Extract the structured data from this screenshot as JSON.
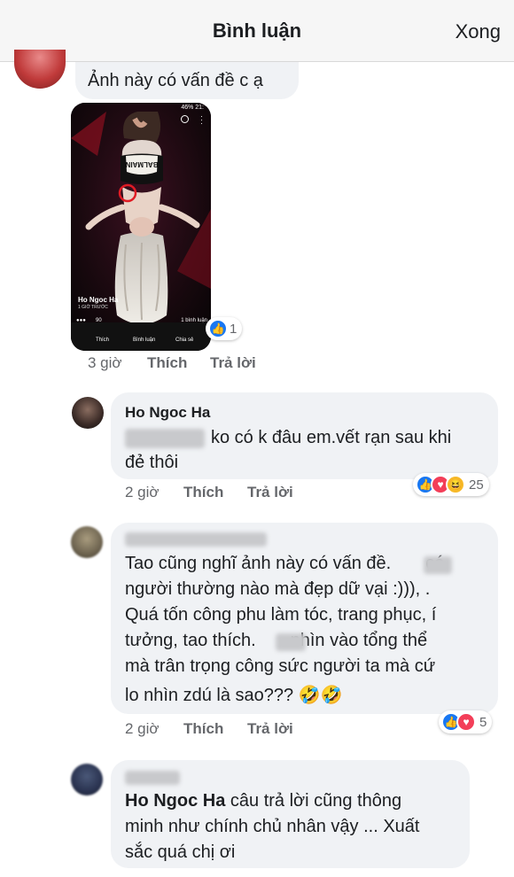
{
  "header": {
    "title": "Bình luận",
    "done": "Xong"
  },
  "comment1": {
    "text": "Ảnh này có vấn đề c ạ",
    "time": "3 giờ",
    "like": "Thích",
    "reply": "Trả lời",
    "reactions": {
      "count": "1"
    },
    "photo": {
      "status": "46% 21:",
      "caption_name": "Ho Ngoc Ha",
      "caption_sub": "1 GIỜ TRƯỚC",
      "reaction_count": "90",
      "comment_count": "1 bình luận",
      "action_like": "Thích",
      "action_comment": "Bình luận",
      "action_share": "Chia sẻ",
      "shirt_text": "BALMAIN"
    }
  },
  "comment2": {
    "name": "Ho Ngoc Ha",
    "text_line1": "ko có k đâu em.vết rạn sau khi",
    "text_line2": "đẻ thôi",
    "time": "2 giờ",
    "like": "Thích",
    "reply": "Trả lời",
    "reactions": {
      "count": "25"
    }
  },
  "comment3": {
    "lines": [
      "Tao cũng nghĩ ảnh này có vấn đề.       có",
      "người thường nào mà đẹp dữ vại :))), .",
      "Quá tốn công phu làm tóc, trang phục, í",
      "tưởng, tao thích.       nhìn vào tổng thể",
      "mà trân trọng công sức người ta mà cứ",
      "lo nhìn zdú là sao??? 🤣🤣"
    ],
    "time": "2 giờ",
    "like": "Thích",
    "reply": "Trả lời",
    "reactions": {
      "count": "5"
    }
  },
  "comment4": {
    "mention": "Ho Ngoc Ha",
    "line1_rest": " câu trả lời cũng thông",
    "line2": "minh như chính chủ nhân vậy ... Xuất",
    "line3": "sắc quá chị ơi"
  },
  "colors": {
    "bubble": "#f0f2f5",
    "like": "#1877f2",
    "love": "#f33e58",
    "haha": "#f7b928"
  },
  "icons": [
    "like-icon",
    "love-icon",
    "haha-icon",
    "search-icon",
    "more-icon"
  ]
}
